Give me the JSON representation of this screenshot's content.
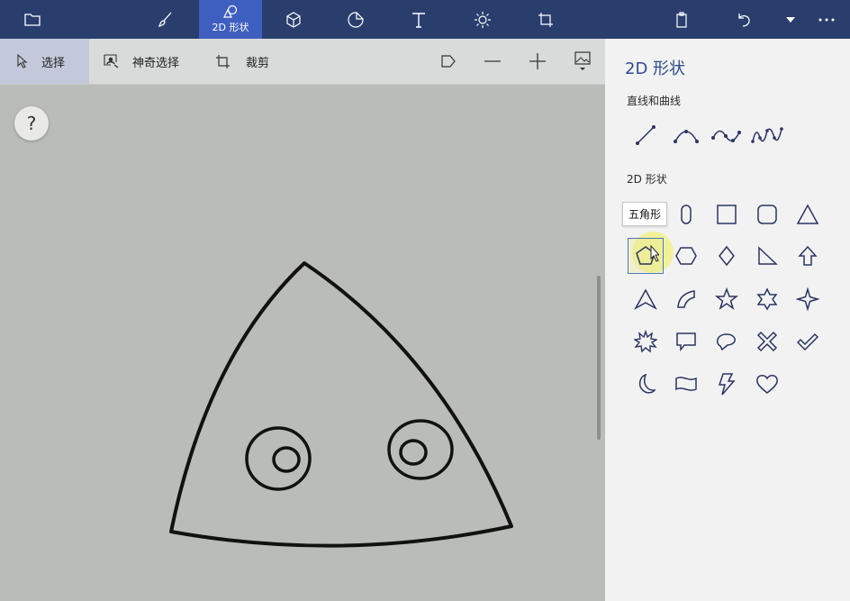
{
  "topbar": {
    "items": [
      {
        "icon": "folder-icon"
      },
      {
        "icon": "brush-icon"
      },
      {
        "icon": "shapes-2d-icon",
        "label": "2D 形状",
        "active": true
      },
      {
        "icon": "cube-3d-icon"
      },
      {
        "icon": "sticker-icon"
      },
      {
        "icon": "text-icon"
      },
      {
        "icon": "effects-icon"
      },
      {
        "icon": "canvas-icon"
      },
      {
        "icon": "paste-icon"
      },
      {
        "icon": "undo-icon"
      },
      {
        "icon": "history-dropdown-icon"
      },
      {
        "icon": "more-icon"
      }
    ]
  },
  "toolbar": {
    "select_label": "选择",
    "magic_select_label": "神奇选择",
    "crop_label": "裁剪",
    "icons": [
      "flag-icon",
      "zoom-out-icon",
      "zoom-in-icon",
      "image-icon"
    ]
  },
  "canvas": {
    "help_label": "?"
  },
  "panel": {
    "title": "2D 形状",
    "lines_section": "直线和曲线",
    "shapes_section": "2D 形状",
    "tooltip": "五角形",
    "line_tools": [
      "line-icon",
      "curve-icon",
      "wave-curve-icon",
      "multi-curve-icon"
    ],
    "shapes": [
      "circle-icon",
      "ellipse-icon",
      "square-icon",
      "rounded-square-icon",
      "triangle-icon",
      "pentagon-icon",
      "hexagon-icon",
      "diamond-icon",
      "right-triangle-icon",
      "arrow-up-icon",
      "arrowhead-icon",
      "quarter-circle-icon",
      "star5-icon",
      "star6-icon",
      "star4-icon",
      "burst-icon",
      "speech-rect-icon",
      "speech-oval-icon",
      "cross-icon",
      "check-icon",
      "moon-icon",
      "banner-icon",
      "lightning-icon",
      "heart-icon"
    ],
    "selected_shape": "pentagon-icon"
  },
  "colors": {
    "topbar": "#2a3e6e",
    "topbar_active": "#3f5fc0",
    "panel_bg": "#f2f2f2",
    "canvas_bg": "#b9bcb8",
    "accent": "#2f4c8f"
  }
}
